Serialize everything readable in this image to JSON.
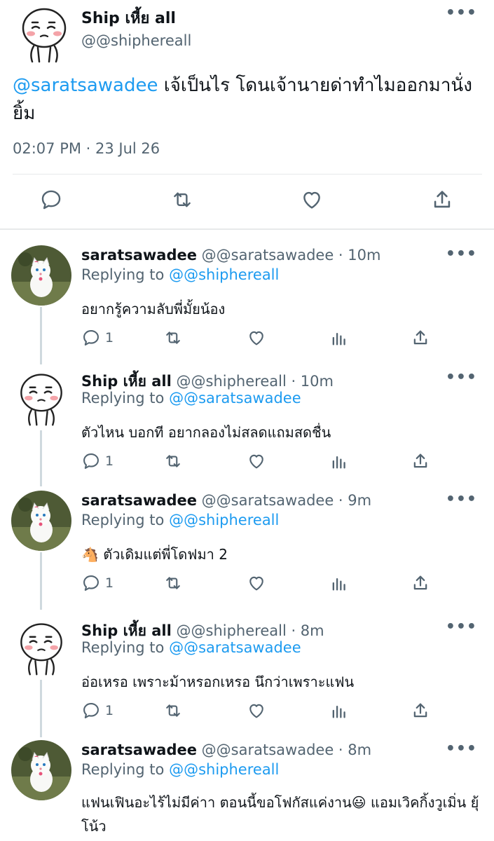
{
  "main_tweet": {
    "display_name": "Ship เหี้ย all",
    "handle": "@@shiphereall",
    "mention": "@saratsawadee",
    "text": " เจ้เป็นไร โดนเจ้านายด่าทำไมออกมานั่งยิ้ม",
    "timestamp": "02:07 PM · 23 Jul 26",
    "more": "•••",
    "actions": [
      "reply-icon",
      "retweet-icon",
      "like-icon",
      "share-icon"
    ]
  },
  "replies": [
    {
      "display_name": "saratsawadee",
      "meta": " @@saratsawadee · 10m",
      "replying_label": "Replying to ",
      "replying_to": "@@shiphereall",
      "text": "อยากรู้ความลับพี่มั้ยน้อง",
      "reply_count": "1",
      "more": "•••",
      "avatar": "cat"
    },
    {
      "display_name": "Ship เหี้ย all",
      "meta": " @@shiphereall · 10m",
      "replying_label": "Replying to ",
      "replying_to": "@@saratsawadee",
      "text": "ตัวไหน บอกที อยากลองไม่สลดแถมสดชื่น",
      "reply_count": "1",
      "more": "•••",
      "avatar": "face"
    },
    {
      "display_name": "saratsawadee",
      "meta": " @@saratsawadee · 9m",
      "replying_label": "Replying to ",
      "replying_to": "@@shiphereall",
      "text": "🐴 ตัวเดิมแต่พี่โดฟมา 2",
      "reply_count": "1",
      "more": "•••",
      "avatar": "cat"
    },
    {
      "display_name": "Ship เหี้ย all",
      "meta": " @@shiphereall · 8m",
      "replying_label": "Replying to ",
      "replying_to": "@@saratsawadee",
      "text": "อ่อเหรอ เพราะม้าหรอกเหรอ นึกว่าเพราะแฟน",
      "reply_count": "1",
      "more": "•••",
      "avatar": "face"
    },
    {
      "display_name": "saratsawadee",
      "meta": " @@saratsawadee · 8m",
      "replying_label": "Replying to ",
      "replying_to": "@@shiphereall",
      "text": "แฟนเฟินอะไร้ไม่มีค่าา ตอนนี้ขอโฟกัสแค่งาน😃  แอมเวิคกิ้งวูเมิ่น ยุ้โน้ว",
      "reply_count": "",
      "more": "•••",
      "avatar": "cat"
    }
  ],
  "colors": {
    "link": "#1d9bf0",
    "secondary_text": "#536471",
    "divider": "#e7e9ea"
  }
}
